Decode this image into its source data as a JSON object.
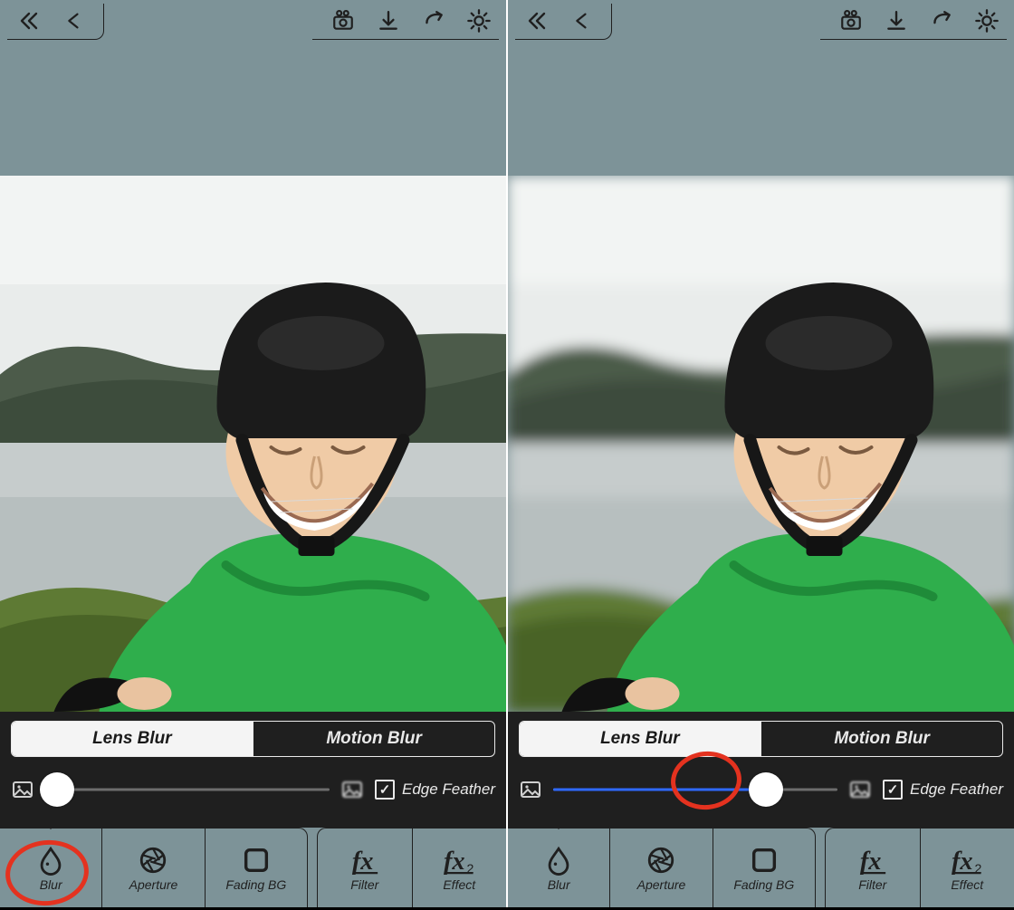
{
  "panes": [
    {
      "blur_background": false,
      "segmented": {
        "lens": "Lens Blur",
        "motion": "Motion Blur",
        "active": "lens"
      },
      "slider": {
        "value_pct": 4,
        "fill_color": "none"
      },
      "edge_feather": {
        "label": "Edge Feather",
        "checked": true
      },
      "tabs_left": [
        {
          "id": "blur",
          "label": "Blur",
          "active": true
        },
        {
          "id": "aperture",
          "label": "Aperture",
          "active": false
        },
        {
          "id": "fadingbg",
          "label": "Fading BG",
          "active": false
        }
      ],
      "tabs_right": [
        {
          "id": "filter",
          "label": "Filter"
        },
        {
          "id": "effect",
          "label": "Effect"
        }
      ],
      "annotation": {
        "target": "tab-blur"
      }
    },
    {
      "blur_background": true,
      "segmented": {
        "lens": "Lens Blur",
        "motion": "Motion Blur",
        "active": "lens"
      },
      "slider": {
        "value_pct": 75,
        "fill_color": "blue"
      },
      "edge_feather": {
        "label": "Edge Feather",
        "checked": true
      },
      "tabs_left": [
        {
          "id": "blur",
          "label": "Blur",
          "active": true
        },
        {
          "id": "aperture",
          "label": "Aperture",
          "active": false
        },
        {
          "id": "fadingbg",
          "label": "Fading BG",
          "active": false
        }
      ],
      "tabs_right": [
        {
          "id": "filter",
          "label": "Filter"
        },
        {
          "id": "effect",
          "label": "Effect"
        }
      ],
      "annotation": {
        "target": "slider-knob"
      }
    }
  ],
  "topbar_icons": [
    "double-chevron-left",
    "chevron-left",
    "camera",
    "download",
    "share",
    "gear"
  ]
}
